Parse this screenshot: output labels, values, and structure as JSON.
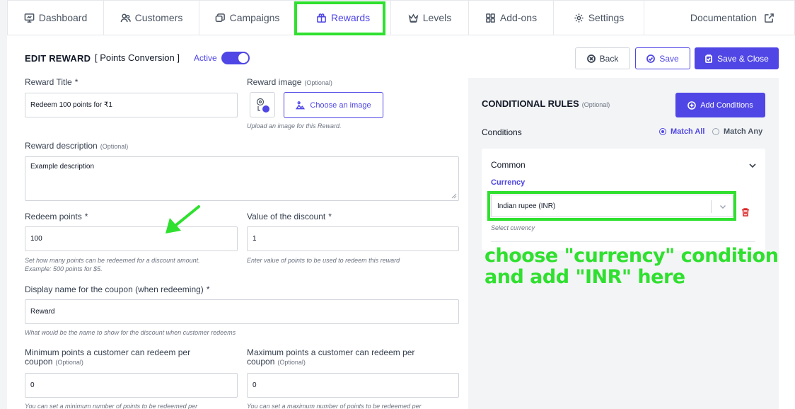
{
  "nav": {
    "tabs": [
      {
        "label": "Dashboard",
        "icon": "monitor-icon"
      },
      {
        "label": "Customers",
        "icon": "users-icon"
      },
      {
        "label": "Campaigns",
        "icon": "campaign-icon"
      },
      {
        "label": "Rewards",
        "icon": "gift-icon",
        "active": true
      },
      {
        "label": "Levels",
        "icon": "crown-icon"
      },
      {
        "label": "Add-ons",
        "icon": "grid-icon"
      },
      {
        "label": "Settings",
        "icon": "gear-icon"
      }
    ],
    "documentation": "Documentation"
  },
  "header": {
    "title": "EDIT REWARD",
    "reward_name": "Points Conversion",
    "status_label": "Active",
    "back_label": "Back",
    "save_label": "Save",
    "save_close_label": "Save & Close"
  },
  "form": {
    "reward_title": {
      "label": "Reward Title",
      "req": "*",
      "value": "Redeem 100 points for ₹1"
    },
    "reward_image": {
      "label": "Reward image",
      "optional": "(Optional)",
      "button": "Choose an image",
      "hint": "Upload an image for this Reward."
    },
    "description": {
      "label": "Reward description",
      "optional": "(Optional)",
      "value": "Example description"
    },
    "redeem_points": {
      "label": "Redeem points",
      "req": "*",
      "value": "100",
      "hint1": "Set how many points can be redeemed for a discount amount.",
      "hint2": "Example: 500 points for $5."
    },
    "discount_value": {
      "label": "Value of the discount",
      "req": "*",
      "value": "1",
      "hint": "Enter value of points to be used to redeem this reward"
    },
    "coupon_name": {
      "label": "Display name for the coupon (when redeeming)",
      "req": "*",
      "value": "Reward",
      "hint": "What would be the name to show for the discount when customer redeems"
    },
    "min_points": {
      "label1": "Minimum points a customer can redeem per",
      "label2": "coupon",
      "optional": "(Optional)",
      "value": "0",
      "hint": "You can set a minimum number of points to be redeemed per"
    },
    "max_points": {
      "label1": "Maximum points a customer can redeem per",
      "label2": "coupon",
      "optional": "(Optional)",
      "value": "0",
      "hint": "You can set a maximum number of points to be redeemed per"
    }
  },
  "conditions": {
    "title": "CONDITIONAL RULES",
    "optional": "(Optional)",
    "add_label": "Add Conditions",
    "sub": "Conditions",
    "match_all": "Match All",
    "match_any": "Match Any",
    "group": "Common",
    "currency_label": "Currency",
    "currency_value": "Indian rupee (INR)",
    "currency_hint": "Select currency"
  },
  "annotation": {
    "line1": "choose \"currency\" condition",
    "line2": "and add \"INR\" here"
  },
  "colors": {
    "accent": "#4f46e5",
    "highlight": "#2fe02f",
    "danger": "#dc2626"
  }
}
